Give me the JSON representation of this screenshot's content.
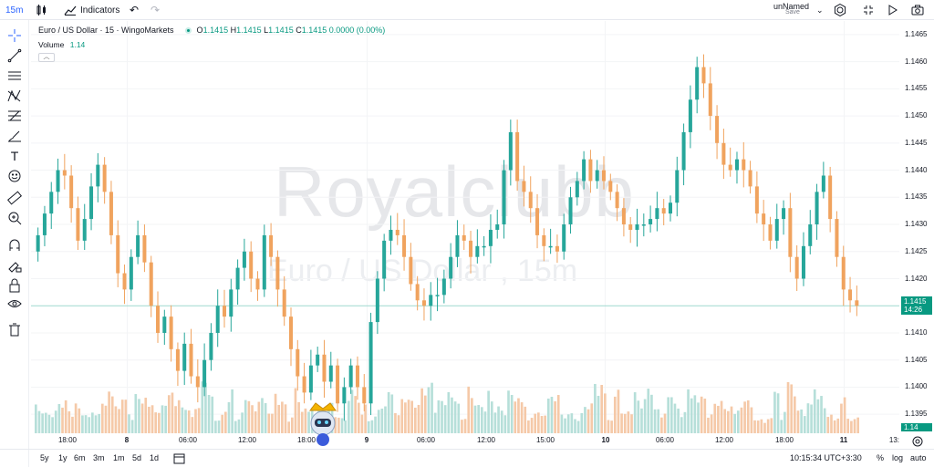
{
  "toolbar": {
    "interval": "15m",
    "indicators_label": "Indicators",
    "layout_name": "unNamed",
    "save_label": "Save"
  },
  "legend": {
    "symbol": "Euro / US Dollar · 15 · WingoMarkets",
    "o_label": "O",
    "o_value": "1.1415",
    "h_label": "H",
    "h_value": "1.1415",
    "l_label": "L",
    "l_value": "1.1415",
    "c_label": "C",
    "c_value": "1.1415",
    "change": "0.0000 (0.00%)",
    "volume_label": "Volume",
    "volume_value": "1.14"
  },
  "watermark": {
    "line1": "Royalclubb",
    "line2": "Euro / US Dollar , 15m"
  },
  "price_axis": {
    "labels": [
      "1.1465",
      "1.1460",
      "1.1455",
      "1.1450",
      "1.1445",
      "1.1440",
      "1.1435",
      "1.1430",
      "1.1425",
      "1.1420",
      "1.1410",
      "1.1405",
      "1.1400",
      "1.1395"
    ],
    "current_price": "1.1415",
    "countdown": "14:26",
    "volume_badge": "1.14"
  },
  "time_axis": {
    "labels": [
      "18:00",
      "8",
      "06:00",
      "12:00",
      "18:00",
      "9",
      "06:00",
      "12:00",
      "15:00",
      "10",
      "06:00",
      "12:00",
      "18:00",
      "11",
      "13:"
    ]
  },
  "bottom": {
    "ranges": [
      "5y",
      "1y",
      "6m",
      "3m",
      "1m",
      "5d",
      "1d"
    ],
    "clock": "10:15:34 UTC+3:30",
    "percent": "%",
    "log": "log",
    "auto": "auto"
  },
  "colors": {
    "up": "#26a69a",
    "down": "#f0a35e",
    "accent": "#2962ff",
    "last_price": "#089981"
  },
  "chart_data": {
    "type": "candlestick",
    "close_series": [
      1.1428,
      1.1432,
      1.1436,
      1.144,
      1.1439,
      1.1433,
      1.1427,
      1.1431,
      1.1437,
      1.1441,
      1.1436,
      1.1428,
      1.1421,
      1.1418,
      1.1424,
      1.1428,
      1.1423,
      1.1415,
      1.141,
      1.1413,
      1.1407,
      1.1403,
      1.1408,
      1.1402,
      1.14,
      1.1405,
      1.141,
      1.1415,
      1.1413,
      1.1418,
      1.1422,
      1.1425,
      1.142,
      1.1418,
      1.1428,
      1.1424,
      1.1418,
      1.1413,
      1.1407,
      1.1402,
      1.1399,
      1.1404,
      1.1406,
      1.1401,
      1.1404,
      1.1397,
      1.14,
      1.1404,
      1.14,
      1.1397,
      1.1412,
      1.142,
      1.1427,
      1.1429,
      1.1428,
      1.1424,
      1.1419,
      1.1416,
      1.1415,
      1.1417,
      1.1417,
      1.142,
      1.1424,
      1.1428,
      1.1427,
      1.1424,
      1.1426,
      1.1426,
      1.1429,
      1.143,
      1.144,
      1.1447,
      1.1438,
      1.1436,
      1.1433,
      1.1428,
      1.1426,
      1.1426,
      1.1425,
      1.143,
      1.1435,
      1.1438,
      1.1442,
      1.1438,
      1.144,
      1.1438,
      1.1436,
      1.1433,
      1.143,
      1.1429,
      1.143,
      1.143,
      1.1431,
      1.1433,
      1.1432,
      1.1434,
      1.144,
      1.1447,
      1.1453,
      1.1459,
      1.1456,
      1.145,
      1.1445,
      1.1441,
      1.144,
      1.1442,
      1.144,
      1.1437,
      1.1432,
      1.143,
      1.1427,
      1.1431,
      1.1433,
      1.1424,
      1.142,
      1.1426,
      1.143,
      1.1436,
      1.1439,
      1.1431,
      1.1424,
      1.1418,
      1.1416,
      1.1415
    ]
  }
}
